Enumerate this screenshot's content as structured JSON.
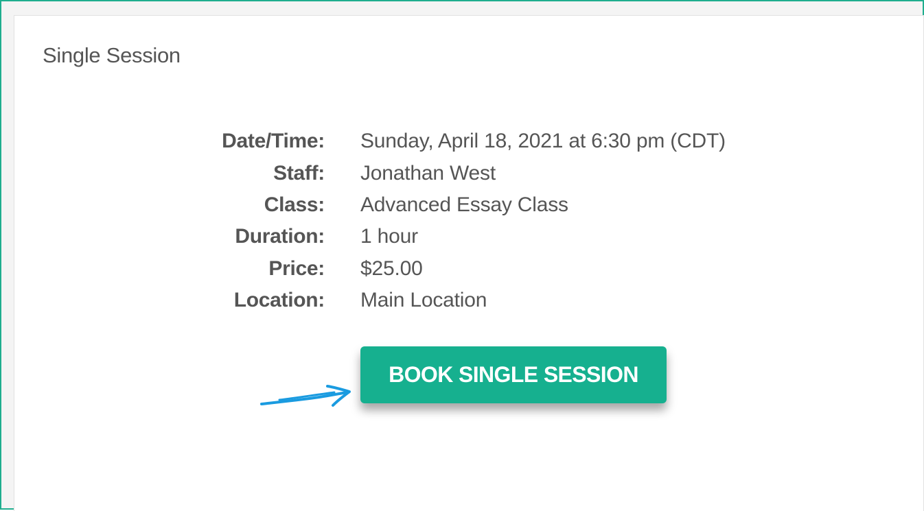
{
  "card": {
    "title": "Single Session"
  },
  "details": [
    {
      "label": "Date/Time:",
      "value": "Sunday, April 18, 2021 at 6:30 pm (CDT)"
    },
    {
      "label": "Staff:",
      "value": "Jonathan West"
    },
    {
      "label": "Class:",
      "value": "Advanced Essay Class"
    },
    {
      "label": "Duration:",
      "value": "1 hour"
    },
    {
      "label": "Price:",
      "value": "$25.00"
    },
    {
      "label": "Location:",
      "value": "Main Location"
    }
  ],
  "book_button": {
    "label": "BOOK SINGLE SESSION"
  },
  "annotation": {
    "icon": "hand-drawn-arrow-icon"
  },
  "colors": {
    "accent": "#16b08f",
    "frame_border": "#1fae8e",
    "text": "#555555",
    "arrow": "#1a9be0"
  }
}
